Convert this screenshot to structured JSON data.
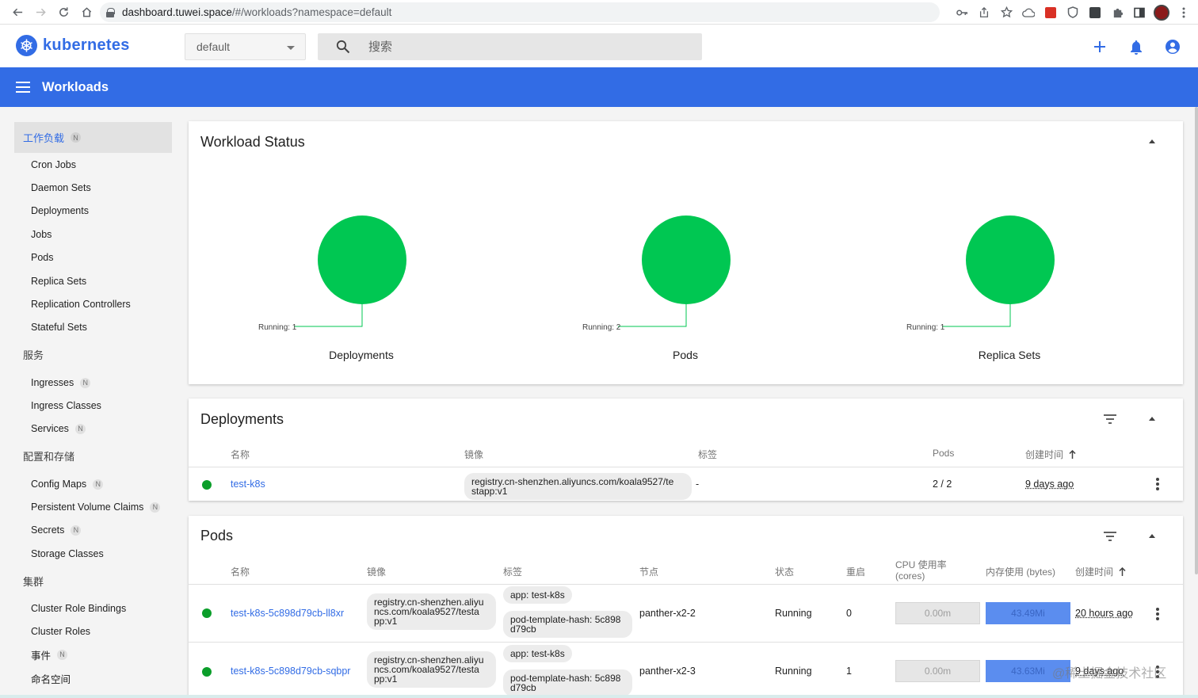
{
  "browser": {
    "url_host": "dashboard.tuwei.space",
    "url_path": "/#/workloads?namespace=default"
  },
  "header": {
    "brand": "kubernetes",
    "namespace": "default",
    "search_placeholder": "搜索",
    "accent": "#326ce5"
  },
  "toolbar": {
    "title": "Workloads"
  },
  "sidebar": {
    "sections": [
      {
        "label": "工作负载",
        "badge": "N",
        "active": true
      },
      {
        "label": "服务"
      },
      {
        "label": "配置和存储"
      },
      {
        "label": "集群"
      }
    ],
    "items": [
      {
        "label": "Cron Jobs"
      },
      {
        "label": "Daemon Sets"
      },
      {
        "label": "Deployments"
      },
      {
        "label": "Jobs"
      },
      {
        "label": "Pods"
      },
      {
        "label": "Replica Sets"
      },
      {
        "label": "Replication Controllers"
      },
      {
        "label": "Stateful Sets"
      },
      {
        "label": "Ingresses",
        "badge": "N"
      },
      {
        "label": "Ingress Classes"
      },
      {
        "label": "Services",
        "badge": "N"
      },
      {
        "label": "Config Maps",
        "badge": "N"
      },
      {
        "label": "Persistent Volume Claims",
        "badge": "N"
      },
      {
        "label": "Secrets",
        "badge": "N"
      },
      {
        "label": "Storage Classes"
      },
      {
        "label": "Cluster Role Bindings"
      },
      {
        "label": "Cluster Roles"
      },
      {
        "label": "事件",
        "badge": "N"
      },
      {
        "label": "命名空间"
      }
    ]
  },
  "workload_status": {
    "title": "Workload Status",
    "running_color": "#00c752",
    "charts": [
      {
        "name": "Deployments",
        "label": "Running: 1",
        "running": 1
      },
      {
        "name": "Pods",
        "label": "Running: 2",
        "running": 2
      },
      {
        "name": "Replica Sets",
        "label": "Running: 1",
        "running": 1
      }
    ]
  },
  "deployments": {
    "title": "Deployments",
    "columns": [
      "名称",
      "镜像",
      "标签",
      "Pods",
      "创建时间"
    ],
    "rows": [
      {
        "name": "test-k8s",
        "image_line1": "registry.cn-shenzhen.aliyuncs.com/koala9527/te",
        "image_line2": "stapp:v1",
        "labels": "-",
        "pods": "2 / 2",
        "created": "9 days ago"
      }
    ]
  },
  "pods": {
    "title": "Pods",
    "columns": [
      "名称",
      "镜像",
      "标签",
      "节点",
      "状态",
      "重启",
      "CPU 使用率",
      "(cores)",
      "内存使用 (bytes)",
      "创建时间"
    ],
    "rows": [
      {
        "name": "test-k8s-5c898d79cb-ll8xr",
        "image_line1": "registry.cn-shenzhen.aliyu",
        "image_line2": "ncs.com/koala9527/testa",
        "image_line3": "pp:v1",
        "label_app": "app: test-k8s",
        "label_hash_line1": "pod-template-hash: 5c898",
        "label_hash_line2": "d79cb",
        "node": "panther-x2-2",
        "status": "Running",
        "restarts": "0",
        "cpu": "0.00m",
        "memory": "43.49Mi",
        "created": "20 hours ago"
      },
      {
        "name": "test-k8s-5c898d79cb-sqbpr",
        "image_line1": "registry.cn-shenzhen.aliyu",
        "image_line2": "ncs.com/koala9527/testa",
        "image_line3": "pp:v1",
        "label_app": "app: test-k8s",
        "label_hash_line1": "pod-template-hash: 5c898",
        "label_hash_line2": "d79cb",
        "node": "panther-x2-3",
        "status": "Running",
        "restarts": "1",
        "cpu": "0.00m",
        "memory": "43.63Mi",
        "created": "9 days ago"
      }
    ]
  },
  "watermark": "@稀土掘金技术社区"
}
